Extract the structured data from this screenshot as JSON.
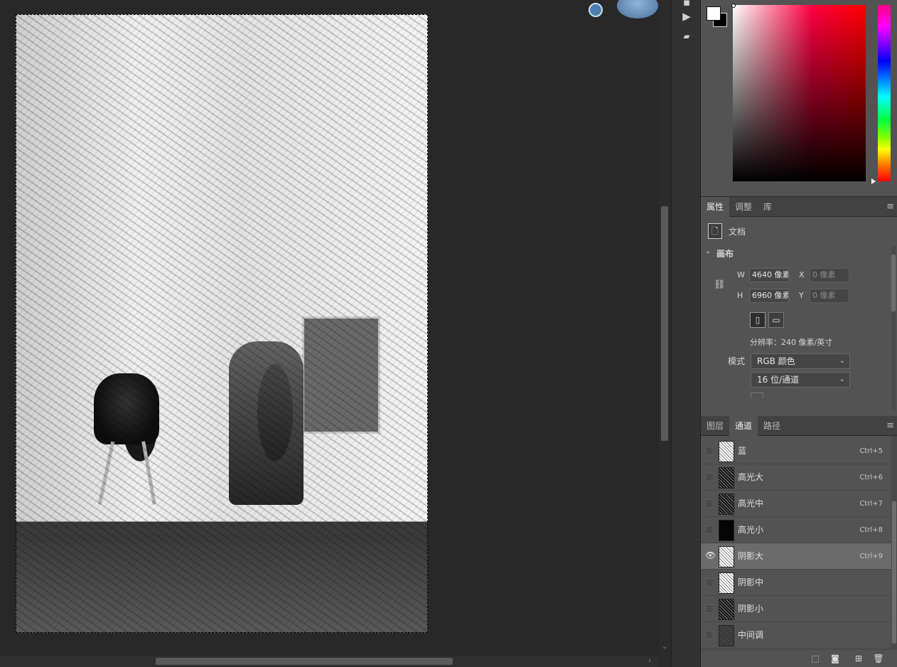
{
  "colors": {
    "fg": "#ffffff",
    "bg": "#000000"
  },
  "properties": {
    "tabs": [
      "属性",
      "调整",
      "库"
    ],
    "doc_label": "文档",
    "section": "画布",
    "w_label": "W",
    "w_value": "4640 像素",
    "h_label": "H",
    "h_value": "6960 像素",
    "x_label": "X",
    "x_value": "0 像素",
    "y_label": "Y",
    "y_value": "0 像素",
    "resolution": "分辨率：240 像素/英寸",
    "mode_label": "模式",
    "mode_value": "RGB 颜色",
    "depth_value": "16 位/通道"
  },
  "channels": {
    "tabs": [
      "图层",
      "通道",
      "路径"
    ],
    "rows": [
      {
        "name": "蓝",
        "shortcut": "Ctrl+5",
        "visible": false
      },
      {
        "name": "高光大",
        "shortcut": "Ctrl+6",
        "visible": false
      },
      {
        "name": "高光中",
        "shortcut": "Ctrl+7",
        "visible": false
      },
      {
        "name": "高光小",
        "shortcut": "Ctrl+8",
        "visible": false
      },
      {
        "name": "阴影大",
        "shortcut": "Ctrl+9",
        "visible": true
      },
      {
        "name": "阴影中",
        "shortcut": "",
        "visible": false
      },
      {
        "name": "阴影小",
        "shortcut": "",
        "visible": false
      },
      {
        "name": "中间调",
        "shortcut": "",
        "visible": false
      }
    ]
  }
}
